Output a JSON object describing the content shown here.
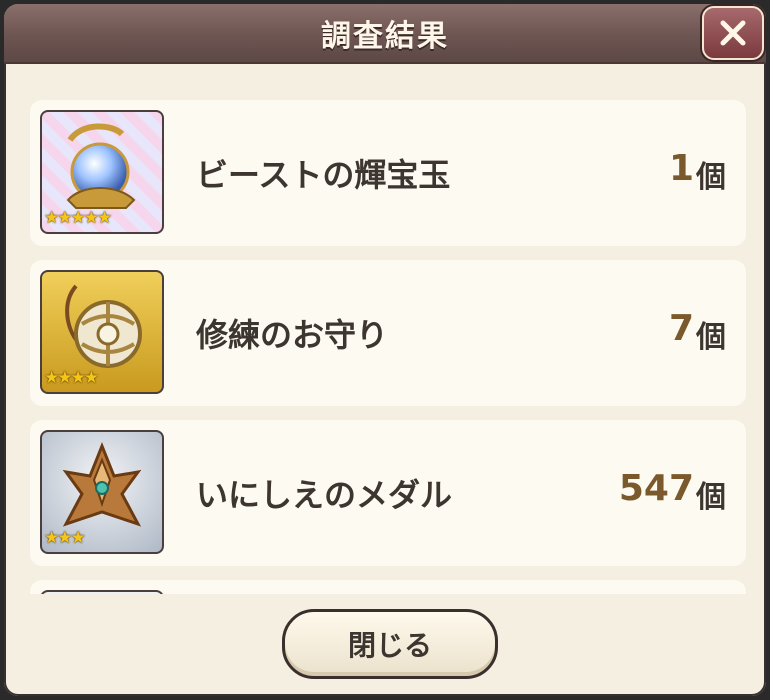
{
  "dialog": {
    "title": "調査結果",
    "close_button": "閉じる",
    "close_icon": "close-x-icon"
  },
  "items": [
    {
      "name": "ビーストの輝宝玉",
      "quantity": "1",
      "unit": "個",
      "stars": "★★★★★",
      "icon": "crystal-orb-icon",
      "rarity": 5
    },
    {
      "name": "修練のお守り",
      "quantity": "7",
      "unit": "個",
      "stars": "★★★★",
      "icon": "gold-amulet-icon",
      "rarity": 4
    },
    {
      "name": "いにしえのメダル",
      "quantity": "547",
      "unit": "個",
      "stars": "★★★",
      "icon": "ancient-medal-icon",
      "rarity": 3
    }
  ],
  "colors": {
    "titlebar": "#6d5552",
    "panel": "#f4efe1",
    "row": "#fdfaf2",
    "quantity": "#7a5a2c",
    "star": "#f5c518"
  }
}
